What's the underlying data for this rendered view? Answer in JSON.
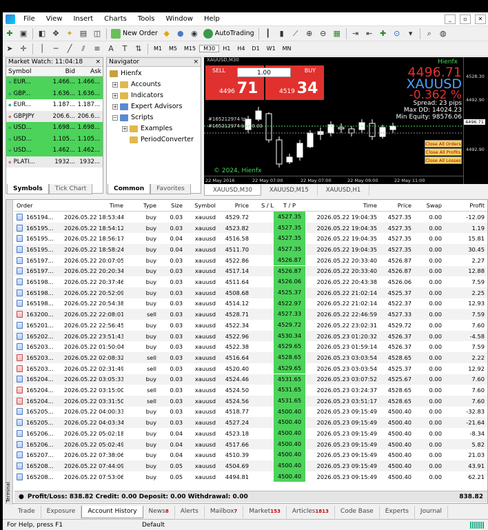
{
  "menu": [
    "File",
    "View",
    "Insert",
    "Charts",
    "Tools",
    "Window",
    "Help"
  ],
  "toolbar": {
    "new_order": "New Order",
    "auto_trading": "AutoTrading",
    "timeframes": [
      "M1",
      "M5",
      "M15",
      "M30",
      "H1",
      "H4",
      "D1",
      "W1",
      "MN"
    ]
  },
  "market_watch": {
    "title": "Market Watch: 11:04:18",
    "headers": [
      "Symbol",
      "Bid",
      "Ask"
    ],
    "rows": [
      {
        "symbol": "EUR...",
        "bid": "1.466...",
        "ask": "1.466...",
        "hl": "green"
      },
      {
        "symbol": "GBP...",
        "bid": "1.636...",
        "ask": "1.636...",
        "hl": "green"
      },
      {
        "symbol": "EUR...",
        "bid": "1.187...",
        "ask": "1.187...",
        "hl": "none"
      },
      {
        "symbol": "GBPJPY",
        "bid": "206.6...",
        "ask": "206.6...",
        "hl": "gray"
      },
      {
        "symbol": "USD...",
        "bid": "1.698...",
        "ask": "1.698...",
        "hl": "green"
      },
      {
        "symbol": "USD...",
        "bid": "1.105...",
        "ask": "1.105...",
        "hl": "green"
      },
      {
        "symbol": "USD...",
        "bid": "1.462...",
        "ask": "1.462...",
        "hl": "green"
      },
      {
        "symbol": "PLATI...",
        "bid": "1932...",
        "ask": "1932...",
        "hl": "gray"
      }
    ],
    "tabs": [
      "Symbols",
      "Tick Chart"
    ]
  },
  "navigator": {
    "title": "Navigator",
    "root": "Hienfx",
    "items": [
      "Accounts",
      "Indicators",
      "Expert Advisors",
      "Scripts"
    ],
    "sub": [
      "Examples",
      "PeriodConverter"
    ],
    "tabs": [
      "Common",
      "Favorites"
    ]
  },
  "chart": {
    "symbol_tf": "XAUUSD,M30",
    "sell": "SELL",
    "buy": "BUY",
    "qty": "1.00",
    "sell_small": "4496",
    "sell_big": "71",
    "buy_small": "4519",
    "buy_big": "34",
    "brand": "Hienfx",
    "price": "4496.71",
    "symbol": "XAUUSD",
    "change": "-0.362 %",
    "spread": "Spread: 23 pips",
    "maxdd": "Max DD: 14024.23",
    "minequity": "Min Equity: 98576.06",
    "tp_label": "#165212974 tp",
    "buy_label": "#165212974 buy 0.03",
    "copyright": "© 2024, Hienfx",
    "buttons": [
      "Close All Orders",
      "Close All Profits",
      "Close All Losses"
    ],
    "yticks": [
      "4528.30",
      "4492.90",
      "4496.71",
      "4492.90"
    ],
    "xticks": [
      "22 May 2016",
      "22 May 07:00",
      "22 May 07:00",
      "22 May 09:00",
      "22 May 11:00"
    ],
    "candles": [
      {
        "o": 0.45,
        "c": 0.3,
        "h": 0.25,
        "l": 0.5
      },
      {
        "o": 0.3,
        "c": 0.18,
        "h": 0.12,
        "l": 0.33
      },
      {
        "o": 0.22,
        "c": 0.6,
        "h": 0.2,
        "l": 0.64
      },
      {
        "o": 0.6,
        "c": 0.95,
        "h": 0.55,
        "l": 1.0
      },
      {
        "o": 0.92,
        "c": 0.85,
        "h": 0.8,
        "l": 0.95
      },
      {
        "o": 0.85,
        "c": 0.65,
        "h": 0.6,
        "l": 0.9
      },
      {
        "o": 0.7,
        "c": 0.5,
        "h": 0.46,
        "l": 0.72
      },
      {
        "o": 0.52,
        "c": 0.48,
        "h": 0.42,
        "l": 0.6
      },
      {
        "o": 0.5,
        "c": 0.38,
        "h": 0.33,
        "l": 0.55
      },
      {
        "o": 0.42,
        "c": 0.44,
        "h": 0.36,
        "l": 0.5
      },
      {
        "o": 0.44,
        "c": 0.5,
        "h": 0.4,
        "l": 0.55
      },
      {
        "o": 0.45,
        "c": 0.35,
        "h": 0.3,
        "l": 0.5
      },
      {
        "o": 0.36,
        "c": 0.55,
        "h": 0.3,
        "l": 0.6
      },
      {
        "o": 0.55,
        "c": 0.42,
        "h": 0.38,
        "l": 0.58
      },
      {
        "o": 0.45,
        "c": 0.4,
        "h": 0.35,
        "l": 0.5
      }
    ]
  },
  "chart_tabs": [
    "XAUUSD,M30",
    "XAUUSD,M15",
    "XAUUSD,H1"
  ],
  "terminal": {
    "title": "Terminal",
    "headers": [
      "Order",
      "Time",
      "Type",
      "Size",
      "Symbol",
      "Price",
      "S / L",
      "T / P",
      "Time",
      "Price",
      "Swap",
      "Profit"
    ],
    "rows": [
      [
        "165194...",
        "2026.05.22 18:53:44",
        "buy",
        "0.03",
        "xauusd",
        "4529.72",
        "",
        "4527.35",
        "2026.05.22 19:04:35",
        "4527.35",
        "0.00",
        "-12.09"
      ],
      [
        "165195...",
        "2026.05.22 18:54:12",
        "buy",
        "0.03",
        "xauusd",
        "4523.82",
        "",
        "4527.35",
        "2026.05.22 19:04:35",
        "4527.35",
        "0.00",
        "1.19"
      ],
      [
        "165195...",
        "2026.05.22 18:56:17",
        "buy",
        "0.04",
        "xauusd",
        "4516.58",
        "",
        "4527.35",
        "2026.05.22 19:04:35",
        "4527.35",
        "0.00",
        "15.81"
      ],
      [
        "165195...",
        "2026.05.22 18:58:24",
        "buy",
        "0.04",
        "xauusd",
        "4511.70",
        "",
        "4527.35",
        "2026.05.22 19:04:35",
        "4527.35",
        "0.00",
        "30.45"
      ],
      [
        "165197...",
        "2026.05.22 20:07:05",
        "buy",
        "0.03",
        "xauusd",
        "4522.86",
        "",
        "4526.87",
        "2026.05.22 20:33:40",
        "4526.87",
        "0.00",
        "2.27"
      ],
      [
        "165197...",
        "2026.05.22 20:20:34",
        "buy",
        "0.03",
        "xauusd",
        "4517.14",
        "",
        "4526.87",
        "2026.05.22 20:33:40",
        "4526.87",
        "0.00",
        "12.88"
      ],
      [
        "165198...",
        "2026.05.22 20:37:46",
        "buy",
        "0.03",
        "xauusd",
        "4511.64",
        "",
        "4526.06",
        "2026.05.22 20:43:38",
        "4526.06",
        "0.00",
        "7.59"
      ],
      [
        "165198...",
        "2026.05.22 20:52:09",
        "buy",
        "0.03",
        "xauusd",
        "4508.68",
        "",
        "4525.37",
        "2026.05.22 21:02:14",
        "4525.37",
        "0.00",
        "2.25"
      ],
      [
        "165198...",
        "2026.05.22 20:54:38",
        "buy",
        "0.03",
        "xauusd",
        "4514.12",
        "",
        "4522.97",
        "2026.05.22 21:02:14",
        "4522.37",
        "0.00",
        "12.93"
      ],
      [
        "163200...",
        "2026.05.22 22:08:01",
        "sell",
        "0.03",
        "xauusd",
        "4528.71",
        "",
        "4527.33",
        "2026.05.22 22:46:59",
        "4527.33",
        "0.00",
        "7.59"
      ],
      [
        "165201...",
        "2026.05.22 22:56:45",
        "buy",
        "0.03",
        "xauusd",
        "4522.34",
        "",
        "4529.72",
        "2026.05.22 23:02:31",
        "4529.72",
        "0.00",
        "7.60"
      ],
      [
        "165202...",
        "2026.05.22 23:51:43",
        "buy",
        "0.03",
        "xauusd",
        "4522.96",
        "",
        "4530.34",
        "2026.05.23 01:20:32",
        "4526.37",
        "0.00",
        "-4.58"
      ],
      [
        "165203...",
        "2026.05.22 01:50:04",
        "buy",
        "0.03",
        "xauusd",
        "4522.38",
        "",
        "4529.65",
        "2026.05.23 01:59:14",
        "4526.37",
        "0.00",
        "7.59"
      ],
      [
        "165203...",
        "2026.05.22 02:08:32",
        "sell",
        "0.03",
        "xauusd",
        "4516.64",
        "",
        "4528.65",
        "2026.05.23 03:03:54",
        "4528.65",
        "0.00",
        "2.22"
      ],
      [
        "165203...",
        "2026.05.22 02:31:49",
        "sell",
        "0.03",
        "xauusd",
        "4520.40",
        "",
        "4529.65",
        "2026.05.23 03:03:54",
        "4525.37",
        "0.00",
        "12.92"
      ],
      [
        "165204...",
        "2026.05.22 03:05:33",
        "buy",
        "0.03",
        "xauusd",
        "4524.46",
        "",
        "4531.65",
        "2026.05.23 03:07:52",
        "4525.67",
        "0.00",
        "7.60"
      ],
      [
        "165204...",
        "2026.05.22 03:15:00",
        "sell",
        "0.03",
        "xauusd",
        "4524.50",
        "",
        "4531.65",
        "2026.05.23 03:24:37",
        "4528.65",
        "0.00",
        "7.60"
      ],
      [
        "165204...",
        "2026.05.22 03:31:50",
        "sell",
        "0.03",
        "xauusd",
        "4524.56",
        "",
        "4531.65",
        "2026.05.23 03:51:17",
        "4528.65",
        "0.00",
        "7.60"
      ],
      [
        "165205...",
        "2026.05.22 04:00:33",
        "buy",
        "0.03",
        "xauusd",
        "4518.77",
        "",
        "4500.40",
        "2026.05.23 09:15:49",
        "4500.40",
        "0.00",
        "-32.83"
      ],
      [
        "165205...",
        "2026.05.22 04:03:34",
        "buy",
        "0.03",
        "xauusd",
        "4527.24",
        "",
        "4500.40",
        "2026.05.23 09:15:49",
        "4500.40",
        "0.00",
        "-21.64"
      ],
      [
        "165206...",
        "2026.05.22 05:02:18",
        "buy",
        "0.04",
        "xauusd",
        "4523.18",
        "",
        "4500.40",
        "2026.05.23 09:15:49",
        "4500.40",
        "0.00",
        "-8.34"
      ],
      [
        "165206...",
        "2026.05.22 05:02:49",
        "buy",
        "0.04",
        "xauusd",
        "4517.66",
        "",
        "4500.40",
        "2026.05.23 09:15:49",
        "4500.40",
        "0.00",
        "5.82"
      ],
      [
        "165207...",
        "2026.05.22 07:38:06",
        "buy",
        "0.04",
        "xauusd",
        "4510.39",
        "",
        "4500.40",
        "2026.05.23 09:15:49",
        "4500.40",
        "0.00",
        "21.03"
      ],
      [
        "165208...",
        "2026.05.22 07:44:09",
        "buy",
        "0.05",
        "xauusd",
        "4504.69",
        "",
        "4500.40",
        "2026.05.23 09:15:49",
        "4500.40",
        "0.00",
        "43.91"
      ],
      [
        "165208...",
        "2026.05.22 07:53:06",
        "buy",
        "0.05",
        "xauusd",
        "4494.81",
        "",
        "4500.40",
        "2026.05.23 09:15:49",
        "4500.40",
        "0.00",
        "62.21"
      ]
    ],
    "summary": "Profit/Loss: 838.82  Credit: 0.00  Deposit: 0.00  Withdrawal: 0.00",
    "total": "838.82",
    "tabs": [
      {
        "label": "Trade",
        "badge": ""
      },
      {
        "label": "Exposure",
        "badge": ""
      },
      {
        "label": "Account History",
        "badge": ""
      },
      {
        "label": "News",
        "badge": "8"
      },
      {
        "label": "Alerts",
        "badge": ""
      },
      {
        "label": "Mailbox",
        "badge": "7"
      },
      {
        "label": "Market",
        "badge": "153"
      },
      {
        "label": "Articles",
        "badge": "1813"
      },
      {
        "label": "Code Base",
        "badge": ""
      },
      {
        "label": "Experts",
        "badge": ""
      },
      {
        "label": "Journal",
        "badge": ""
      }
    ]
  },
  "status": {
    "help": "For Help, press F1",
    "profile": "Default"
  },
  "colors": {
    "green": "#4cd35a",
    "sell_red": "#e0312e",
    "chart_bg": "#000000",
    "blue_text": "#4aa3ff"
  }
}
